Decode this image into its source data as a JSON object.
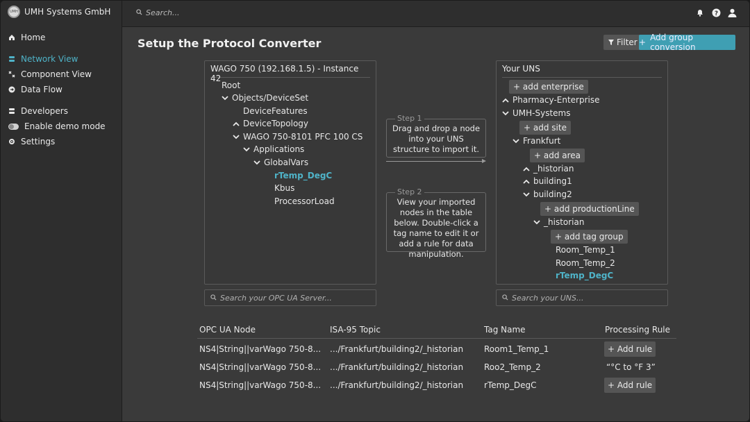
{
  "brand": {
    "name": "UMH Systems GmbH",
    "logo_text": "UMH"
  },
  "nav": [
    {
      "label": "Home",
      "icon": "home-icon"
    },
    {
      "label": "Network View",
      "icon": "network-icon",
      "active": true
    },
    {
      "label": "Component View",
      "icon": "component-icon"
    },
    {
      "label": "Data Flow",
      "icon": "dataflow-icon"
    },
    {
      "label": "Developers",
      "icon": "developers-icon"
    },
    {
      "label": "Enable demo mode",
      "icon": "toggle-icon"
    },
    {
      "label": "Settings",
      "icon": "gear-icon"
    }
  ],
  "topbar": {
    "search_placeholder": "Search..."
  },
  "page": {
    "title": "Setup the Protocol Converter",
    "filter_label": "Filter",
    "add_group_label": "Add group conversion"
  },
  "opc": {
    "title": "WAGO 750 (192.168.1.5) - Instance 42",
    "tree": [
      "Root",
      "Objects/DeviceSet",
      "DeviceFeatures",
      "DeviceTopology",
      "WAGO 750-8101 PFC 100 CS",
      "Applications",
      "GlobalVars",
      "rTemp_DegC",
      "Kbus",
      "ProcessorLoad"
    ],
    "search_placeholder": "Search your OPC UA Server..."
  },
  "steps": [
    {
      "label": "Step 1",
      "text": "Drag and drop a node into your UNS structure to import it."
    },
    {
      "label": "Step 2",
      "text": "View your imported nodes in the table below. Double-click a tag name to edit it or add a rule for data manipulation."
    }
  ],
  "uns": {
    "title": "Your UNS",
    "add_enterprise": "+ add enterprise",
    "pharma": "Pharmacy-Enterprise",
    "umh": "UMH-Systems",
    "add_site": "+ add site",
    "frankfurt": "Frankfurt",
    "add_area": "+ add area",
    "historian1": "_historian",
    "building1": "building1",
    "building2": "building2",
    "add_line": "+ add productionLine",
    "historian2": "_historian",
    "add_tag_group": "+ add tag group",
    "room1": "Room_Temp_1",
    "room2": "Room_Temp_2",
    "rtemp": "rTemp_DegC",
    "search_placeholder": "Search your UNS..."
  },
  "table": {
    "headers": [
      "OPC UA Node",
      "ISA-95 Topic",
      "Tag Name",
      "Processing Rule"
    ],
    "rows": [
      {
        "node": "NS4|String||varWago 750-8...",
        "topic": ".../Frankfurt/building2/_historian",
        "tag": "Room1_Temp_1",
        "rule": "+ Add rule",
        "rule_is_button": true
      },
      {
        "node": "NS4|String||varWago 750-8...",
        "topic": ".../Frankfurt/building2/_historian",
        "tag": "Roo2_Temp_2",
        "rule": "“°C to °F 3”",
        "rule_is_button": false
      },
      {
        "node": "NS4|String||varWago 750-8...",
        "topic": ".../Frankfurt/building2/_historian",
        "tag": "rTemp_DegC",
        "rule": "+ Add rule",
        "rule_is_button": true
      }
    ]
  },
  "colors": {
    "accent": "#4fb3c8",
    "button": "#3f9fb3",
    "background": "#3a3a3a",
    "sidebar": "#2e2e2e"
  }
}
